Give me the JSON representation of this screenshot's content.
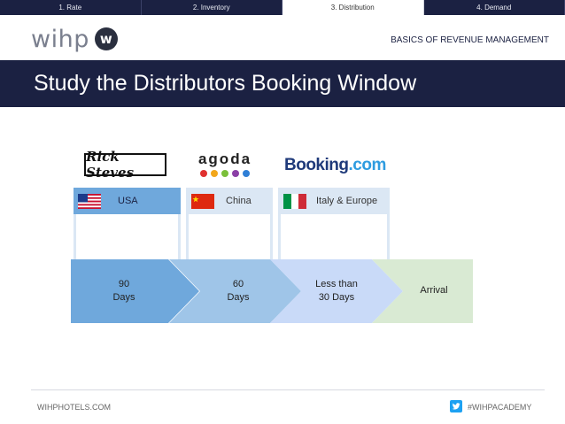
{
  "tabs": [
    {
      "label": "1. Rate"
    },
    {
      "label": "2. Inventory"
    },
    {
      "label": "3. Distribution"
    },
    {
      "label": "4. Demand"
    }
  ],
  "logo": {
    "text": "wihp",
    "mark": "w"
  },
  "header_title": "BASICS OF REVENUE MANAGEMENT",
  "slide_title": "Study the Distributors Booking Window",
  "distributors": {
    "rick_steves": "Rick Steves",
    "agoda": "agoda",
    "booking_part1": "Booking",
    "booking_part2": ".com"
  },
  "countries": {
    "usa": "USA",
    "china": "China",
    "italy": "Italy & Europe"
  },
  "booking_window": {
    "step1_line1": "90",
    "step1_line2": "Days",
    "step2_line1": "60",
    "step2_line2": "Days",
    "step3_line1": "Less than",
    "step3_line2": "30 Days",
    "step4": "Arrival"
  },
  "footer": {
    "website": "WIHPHOTELS.COM",
    "hashtag": "#WIHPACADEMY"
  },
  "colors": {
    "navy": "#1b2142",
    "blue_dark": "#6fa8dc",
    "blue_mid": "#9fc5e8",
    "blue_light": "#c9daf8",
    "green_light": "#d9ead3",
    "twitter": "#1da1f2"
  }
}
